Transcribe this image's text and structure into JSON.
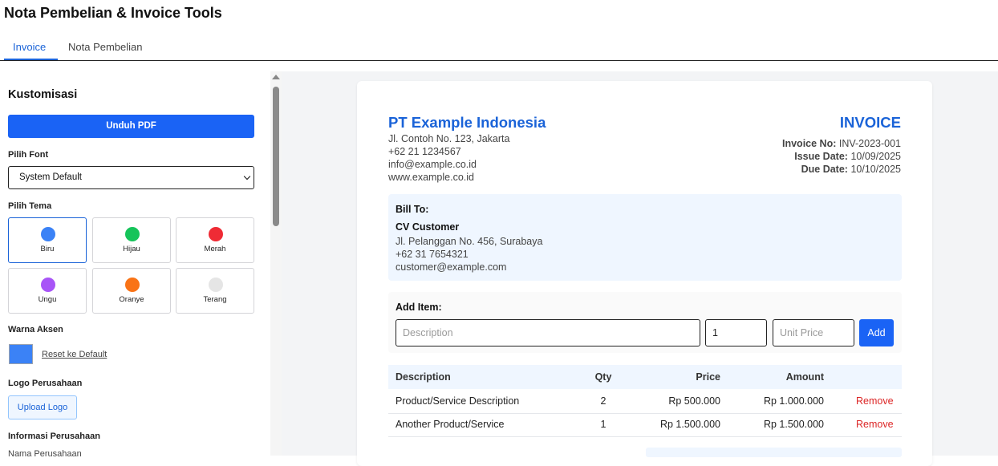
{
  "app": {
    "title": "Nota Pembelian & Invoice Tools"
  },
  "tabs": [
    {
      "label": "Invoice",
      "active": true
    },
    {
      "label": "Nota Pembelian",
      "active": false
    }
  ],
  "sidebar": {
    "heading": "Kustomisasi",
    "download_label": "Unduh PDF",
    "font_label": "Pilih Font",
    "font_value": "System Default",
    "theme_label": "Pilih Tema",
    "themes": [
      {
        "name": "Biru",
        "color": "#3b82f6",
        "selected": true
      },
      {
        "name": "Hijau",
        "color": "#16c45a",
        "selected": false
      },
      {
        "name": "Merah",
        "color": "#ef2b35",
        "selected": false
      },
      {
        "name": "Ungu",
        "color": "#a855f7",
        "selected": false
      },
      {
        "name": "Oranye",
        "color": "#f97316",
        "selected": false
      },
      {
        "name": "Terang",
        "color": "#e5e5e5",
        "selected": false
      }
    ],
    "accent_label": "Warna Aksen",
    "accent_color": "#3b82f6",
    "reset_label": "Reset ke Default",
    "logo_label": "Logo Perusahaan",
    "upload_label": "Upload Logo",
    "company_info_label": "Informasi Perusahaan",
    "company_name_field_label": "Nama Perusahaan"
  },
  "invoice": {
    "company_name": "PT Example Indonesia",
    "company_address": "Jl. Contoh No. 123, Jakarta",
    "company_phone": "+62 21 1234567",
    "company_email": "info@example.co.id",
    "company_web": "www.example.co.id",
    "title": "INVOICE",
    "invoice_no_label": "Invoice No:",
    "invoice_no": "INV-2023-001",
    "issue_date_label": "Issue Date:",
    "issue_date": "10/09/2025",
    "due_date_label": "Due Date:",
    "due_date": "10/10/2025",
    "bill_to_label": "Bill To:",
    "customer_name": "CV Customer",
    "customer_address": "Jl. Pelanggan No. 456, Surabaya",
    "customer_phone": "+62 31 7654321",
    "customer_email": "customer@example.com",
    "add_item_label": "Add Item:",
    "description_placeholder": "Description",
    "qty_value": "1",
    "unit_price_placeholder": "Unit Price",
    "add_button_label": "Add",
    "columns": {
      "description": "Description",
      "qty": "Qty",
      "price": "Price",
      "amount": "Amount"
    },
    "items": [
      {
        "description": "Product/Service Description",
        "qty": "2",
        "price": "Rp 500.000",
        "amount": "Rp 1.000.000",
        "action": "Remove"
      },
      {
        "description": "Another Product/Service",
        "qty": "1",
        "price": "Rp 1.500.000",
        "amount": "Rp 1.500.000",
        "action": "Remove"
      }
    ]
  }
}
